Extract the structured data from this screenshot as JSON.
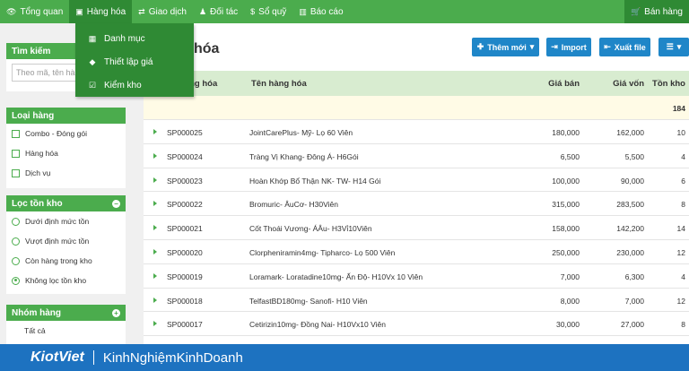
{
  "nav": {
    "items": [
      {
        "icon": "eye-icon",
        "glyph": "👁",
        "label": "Tổng quan"
      },
      {
        "icon": "cube-icon",
        "glyph": "▣",
        "label": "Hàng hóa"
      },
      {
        "icon": "exchange-icon",
        "glyph": "⇄",
        "label": "Giao dịch"
      },
      {
        "icon": "person-icon",
        "glyph": "♟",
        "label": "Đối tác"
      },
      {
        "icon": "dollar-icon",
        "glyph": "$",
        "label": "Sổ quỹ"
      },
      {
        "icon": "bar-chart-icon",
        "glyph": "▥",
        "label": "Báo cáo"
      }
    ],
    "right": {
      "icon": "cart-icon",
      "glyph": "🛒",
      "label": "Bán hàng"
    }
  },
  "dropdown": [
    {
      "icon": "grid-icon",
      "glyph": "▦",
      "label": "Danh mục"
    },
    {
      "icon": "tag-icon",
      "glyph": "◆",
      "label": "Thiết lập giá"
    },
    {
      "icon": "checkbox-icon",
      "glyph": "☑",
      "label": "Kiểm kho"
    }
  ],
  "sidebar": {
    "search": {
      "title": "Tìm kiếm",
      "placeholder": "Theo mã, tên hàng"
    },
    "category": {
      "title": "Loại hàng",
      "items": [
        "Combo - Đóng gói",
        "Hàng hóa",
        "Dịch vụ"
      ]
    },
    "stock": {
      "title": "Lọc tồn kho",
      "items": [
        "Dưới định mức tồn",
        "Vượt định mức tồn",
        "Còn hàng trong kho",
        "Không lọc tồn kho"
      ],
      "selected": 3
    },
    "group": {
      "title": "Nhóm hàng",
      "items": [
        "Tất cả"
      ]
    }
  },
  "main": {
    "title": "hóa",
    "buttons": {
      "add": "Thêm mới",
      "import": "Import",
      "export": "Xuất file"
    },
    "columns": {
      "code": "hàng hóa",
      "name": "Tên hàng hóa",
      "price": "Giá bán",
      "cost": "Giá vốn",
      "stock": "Tồn kho"
    },
    "total_stock": "184",
    "rows": [
      {
        "code": "SP000025",
        "name": "JointCarePlus- Mỹ- Lọ 60 Viên",
        "price": "180,000",
        "cost": "162,000",
        "stock": "10"
      },
      {
        "code": "SP000024",
        "name": "Tràng Vị Khang- Đông Á- H6Gói",
        "price": "6,500",
        "cost": "5,500",
        "stock": "4"
      },
      {
        "code": "SP000023",
        "name": "Hoàn Khớp Bổ Thận NK- TW- H14 Gói",
        "price": "100,000",
        "cost": "90,000",
        "stock": "6"
      },
      {
        "code": "SP000022",
        "name": "Bromuric- ÂuCơ- H30Viên",
        "price": "315,000",
        "cost": "283,500",
        "stock": "8"
      },
      {
        "code": "SP000021",
        "name": "Cốt Thoái Vương- ÁÂu- H3Vỉ10Viên",
        "price": "158,000",
        "cost": "142,200",
        "stock": "14"
      },
      {
        "code": "SP000020",
        "name": "Clorpheniramin4mg- Tipharco- Lọ 500 Viên",
        "price": "250,000",
        "cost": "230,000",
        "stock": "12"
      },
      {
        "code": "SP000019",
        "name": "Loramark- Loratadine10mg- Ấn Độ- H10Vx 10 Viên",
        "price": "7,000",
        "cost": "6,300",
        "stock": "4"
      },
      {
        "code": "SP000018",
        "name": "TelfastBD180mg- Sanofi- H10 Viên",
        "price": "8,000",
        "cost": "7,000",
        "stock": "12"
      },
      {
        "code": "SP000017",
        "name": "Cetirizin10mg- Đồng Nai- H10Vx10 Viên",
        "price": "30,000",
        "cost": "27,000",
        "stock": "8"
      }
    ]
  },
  "footer": {
    "brand": "KiotViet",
    "tagline": "KinhNghiệmKinhDoanh"
  },
  "colors": {
    "primary_green": "#4bac4d",
    "dark_green": "#2f8a34",
    "button_blue": "#1f86c8",
    "footer_blue": "#1d72c0"
  }
}
